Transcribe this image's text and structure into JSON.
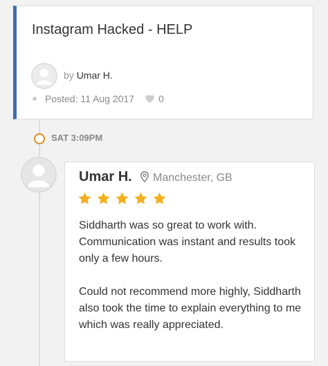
{
  "post": {
    "title": "Instagram Hacked - HELP",
    "by_prefix": "by",
    "author": "Umar H.",
    "posted": "Posted: 11 Aug 2017",
    "likes": "0"
  },
  "timeline": {
    "time": "SAT 3:09PM"
  },
  "review": {
    "name": "Umar H.",
    "location": "Manchester, GB",
    "rating": 5,
    "paragraphs": [
      "Siddharth was so great to work with. Communication was instant and results took only a few hours.",
      "Could not recommend more highly, Siddharth also took the time to explain everything to me which was really appreciated."
    ]
  },
  "colors": {
    "accent_border": "#3a6fb5",
    "timeline_node": "#e08a1e",
    "star": "#f2b01e"
  },
  "icons": {
    "avatar": "user-placeholder-icon",
    "heart": "heart-icon",
    "location": "map-pin-icon",
    "star": "star-icon"
  }
}
